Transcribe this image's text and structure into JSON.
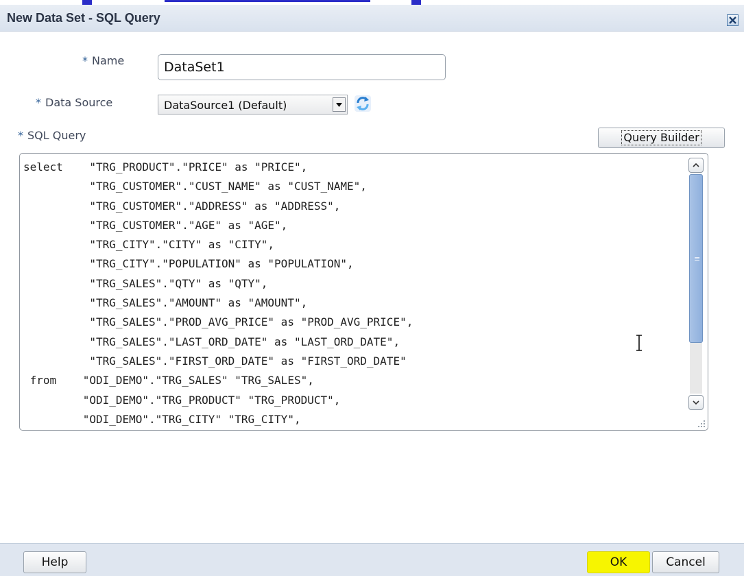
{
  "dialog": {
    "title": "New Data Set - SQL Query"
  },
  "form": {
    "required_marker": "*",
    "name_label": "Name",
    "name_value": "DataSet1",
    "datasource_label": "Data Source",
    "datasource_value": "DataSource1 (Default)",
    "sql_label": "SQL Query",
    "query_builder_label": "Query Builder",
    "sql_text": "select    \"TRG_PRODUCT\".\"PRICE\" as \"PRICE\",\n          \"TRG_CUSTOMER\".\"CUST_NAME\" as \"CUST_NAME\",\n          \"TRG_CUSTOMER\".\"ADDRESS\" as \"ADDRESS\",\n          \"TRG_CUSTOMER\".\"AGE\" as \"AGE\",\n          \"TRG_CITY\".\"CITY\" as \"CITY\",\n          \"TRG_CITY\".\"POPULATION\" as \"POPULATION\",\n          \"TRG_SALES\".\"QTY\" as \"QTY\",\n          \"TRG_SALES\".\"AMOUNT\" as \"AMOUNT\",\n          \"TRG_SALES\".\"PROD_AVG_PRICE\" as \"PROD_AVG_PRICE\",\n          \"TRG_SALES\".\"LAST_ORD_DATE\" as \"LAST_ORD_DATE\",\n          \"TRG_SALES\".\"FIRST_ORD_DATE\" as \"FIRST_ORD_DATE\"\n from    \"ODI_DEMO\".\"TRG_SALES\" \"TRG_SALES\",\n         \"ODI_DEMO\".\"TRG_PRODUCT\" \"TRG_PRODUCT\",\n         \"ODI_DEMO\".\"TRG_CITY\" \"TRG_CITY\","
  },
  "footer": {
    "help_label": "Help",
    "ok_label": "OK",
    "cancel_label": "Cancel"
  },
  "icons": {
    "close": "close-icon",
    "dropdown": "chevron-down-icon",
    "refresh": "refresh-icon",
    "scroll_up": "chevron-up-icon",
    "scroll_down": "chevron-down-icon",
    "text_cursor": "text-cursor-icon"
  },
  "colors": {
    "ok_highlight": "#f7f500",
    "title_bar": "#dfe6f0",
    "scroll_thumb": "#8fb0dd"
  }
}
